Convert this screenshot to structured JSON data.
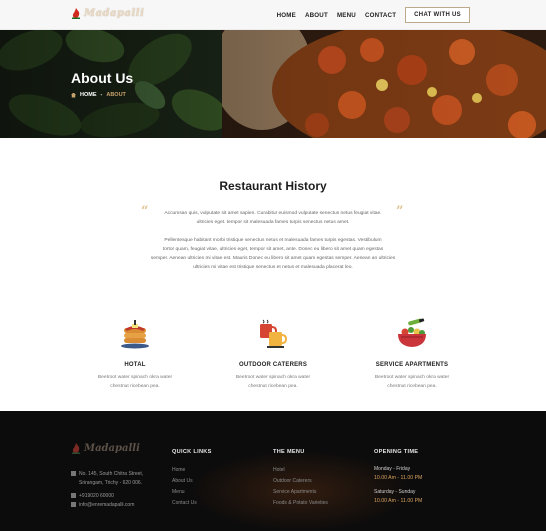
{
  "header": {
    "logo_text": "Madapalli",
    "nav": [
      "HOME",
      "ABOUT",
      "MENU",
      "CONTACT"
    ],
    "chat_button": "CHAT WITH US"
  },
  "hero": {
    "title": "About Us",
    "breadcrumb_home": "HOME",
    "breadcrumb_current": "ABOUT"
  },
  "history": {
    "title": "Restaurant History",
    "para1_line1": "Accumsan quis, vulputate sit amet sapien. Curabitur euismod vulputate senectus netus feugiat vitae.",
    "para1_line2": "ultricies eget. tempor sit malesuada fames turpis senectus netus amet.",
    "para2_line1": "Pellentesque habitant morbi tristique senectus netus et malesuada fames turpis egestas. Vestibulum",
    "para2_line2": "tortor quam, feugiat vitae, ultricies eget, tempor sit amet, ante. Donec eu libero sit amet quam egestas",
    "para2_line3": "semper. Aenean ultricies mi vitae est. Mauris Donec eu libero sit amet quam egestas semper. Aenean an ultricies",
    "para2_line4": "ultricies mi vitae est tristique senectus et netus et malesuada placerat leo."
  },
  "features": [
    {
      "title": "HOTAL",
      "desc": "Beetroot water spinach okra water chestnut ricebean pea.",
      "icon": "pancake-stack-icon"
    },
    {
      "title": "OUTDOOR CATERERS",
      "desc": "Beetroot water spinach okra water chestnut ricebean pea.",
      "icon": "coffee-cups-icon"
    },
    {
      "title": "SERVICE APARTMENTS",
      "desc": "Beetroot water spinach okra water chestnut ricebean pea.",
      "icon": "salad-bowl-icon"
    }
  ],
  "footer": {
    "logo_text": "Madapalli",
    "address_line1": "No. 145, South Chitra Street,",
    "address_line2": "Srirangam, Trichy - 620 006.",
    "phone": "+919020 60000",
    "email": "info@enremadapalli.com",
    "quick_links_title": "QUICK LINKS",
    "quick_links": [
      "Home",
      "About Us",
      "Menu",
      "Contact Us"
    ],
    "menu_title": "THE MENU",
    "menu_links": [
      "Hotel",
      "Outdoor Caterers",
      "Service Apartments",
      "Foods & Potato Varieties"
    ],
    "opening_title": "OPENING TIME",
    "weekday_label": "Monday - Friday",
    "weekday_hours": "10.00 Am - 11.00 PM",
    "weekend_label": "Saturday - Sunday",
    "weekend_hours": "10.00 Am - 11.00 PM"
  },
  "colors": {
    "accent_gold": "#c9a26b",
    "footer_bg": "#0d0c0c",
    "quote_color": "#e2c28f"
  }
}
